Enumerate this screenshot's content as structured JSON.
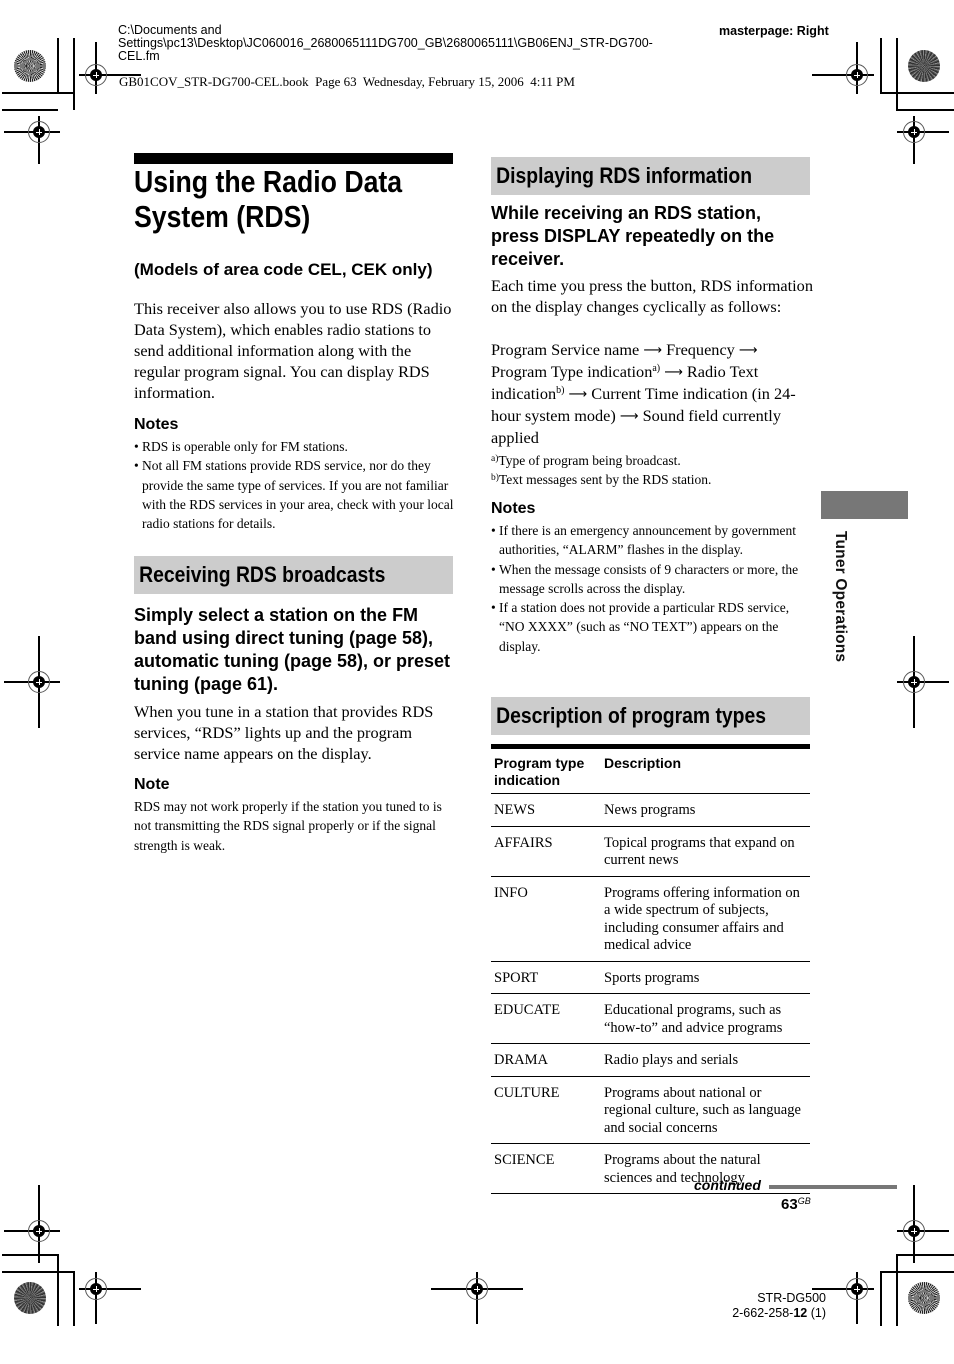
{
  "header": {
    "path_line1": "C:\\Documents and",
    "path_line2": "Settings\\pc13\\Desktop\\JC060016_2680065111DG700_GB\\2680065111\\GB06ENJ_STR-DG700-",
    "path_line3": "CEL.fm",
    "book_info": "GB01COV_STR-DG700-CEL.book  Page 63  Wednesday, February 15, 2006  4:11 PM",
    "masterpage": "masterpage: Right"
  },
  "left": {
    "title_line1": "Using the Radio Data",
    "title_line2": "System (RDS)",
    "subhead": "(Models of area code CEL, CEK only)",
    "intro": "This receiver also allows you to use RDS (Radio Data System), which enables radio stations to send additional information along with the regular program signal. You can display RDS information.",
    "notes_heading": "Notes",
    "notes": [
      "RDS is operable only for FM stations.",
      "Not all FM stations provide RDS service, nor do they provide the same type of services. If you are not familiar with the RDS services in your area, check with your local radio stations for details."
    ],
    "section2_title": "Receiving RDS broadcasts",
    "section2_step": "Simply select a station on the FM band using direct tuning (page 58), automatic tuning (page 58), or preset tuning (page 61).",
    "section2_body": "When you tune in a station that provides RDS services, “RDS” lights up and the program service name appears on the display.",
    "note_heading": "Note",
    "note_text": "RDS may not work properly if the station you tuned to is not transmitting the RDS signal properly or if the signal strength is weak."
  },
  "right": {
    "section1_title": "Displaying RDS information",
    "step": "While receiving an RDS station, press DISPLAY repeatedly on the receiver.",
    "body": "Each time you press the button, RDS information on the display changes cyclically as follows:",
    "cycle": {
      "item1": "Program Service name",
      "item2": "Frequency",
      "item3": "Program Type indication",
      "item3_sup": "a)",
      "item4a": "Radio Text",
      "item4b": "indication",
      "item4_sup": "b)",
      "item5": "Current Time indication (in 24-hour system mode)",
      "item6": "Sound field currently applied",
      "arrow": "⟶"
    },
    "footnotes": [
      {
        "mark": "a)",
        "text": "Type of program being broadcast."
      },
      {
        "mark": "b)",
        "text": "Text messages sent by the RDS station."
      }
    ],
    "notes_heading": "Notes",
    "notes": [
      "If there is an emergency announcement by government authorities, “ALARM” flashes in the display.",
      "When the message consists of 9 characters or more, the message scrolls across the display.",
      "If a station does not provide a particular RDS service, “NO XXXX” (such as “NO TEXT”) appears on the display."
    ],
    "section2_title": "Description of program types",
    "table": {
      "headers": [
        "Program type indication",
        "Description"
      ],
      "rows": [
        [
          "NEWS",
          "News programs"
        ],
        [
          "AFFAIRS",
          "Topical programs that expand on current news"
        ],
        [
          "INFO",
          "Programs offering information on a wide spectrum of subjects, including consumer affairs and medical advice"
        ],
        [
          "SPORT",
          "Sports programs"
        ],
        [
          "EDUCATE",
          "Educational programs, such as “how-to” and advice programs"
        ],
        [
          "DRAMA",
          "Radio plays and serials"
        ],
        [
          "CULTURE",
          "Programs about national or regional culture, such as language and social concerns"
        ],
        [
          "SCIENCE",
          "Programs about the natural sciences and technology"
        ]
      ]
    }
  },
  "side_tab": {
    "label": "Tuner Operations"
  },
  "footer": {
    "continued": "continued",
    "page_number": "63",
    "page_suffix": "GB",
    "model": "STR-DG500",
    "part_prefix": "2-662-258-",
    "part_bold": "12",
    "part_suffix": " (1)"
  }
}
